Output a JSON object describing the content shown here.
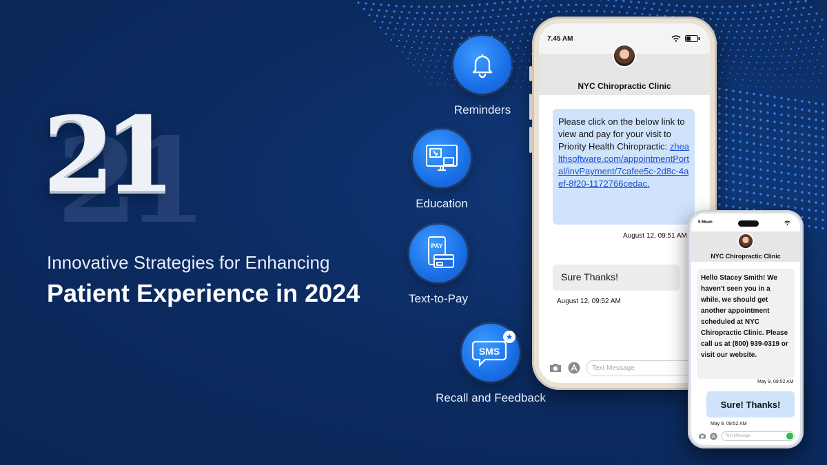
{
  "hero": {
    "number": "21",
    "subtitle": "Innovative Strategies for Enhancing",
    "title": "Patient Experience in 2024"
  },
  "features": [
    {
      "label": "Reminders",
      "icon": "bell-icon"
    },
    {
      "label": "Education",
      "icon": "monitor-icon"
    },
    {
      "label": "Text-to-Pay",
      "icon": "phone-pay-icon",
      "badge": "PAY"
    },
    {
      "label": "Recall and Feedback",
      "icon": "sms-icon",
      "badge": "SMS"
    }
  ],
  "phone_large": {
    "time": "7.45 AM",
    "contact": "NYC Chiropractic Clinic",
    "message_text": "Please click on the below link to view and pay for your visit to Priority Health Chiropractic:",
    "message_link": "zhealthsoftware.com/appointmentPortal/invPayment/7cafee5c-2d8c-4aef-8f20-1172766cedac.",
    "message_time": "August 12,  09:51 AM",
    "reply": "Sure Thanks!",
    "reply_time": "August 12,  09:52 AM",
    "composer_placeholder": "Text Message"
  },
  "phone_small": {
    "time": "9:56am",
    "contact": "NYC Chiropractic Clinic",
    "message": "Hello Stacey Smith! We haven't seen you in a while, we should get another appointment scheduled at NYC Chiropractic Clinic. Please call us at (800) 939-0319 or visit our website.",
    "message_time": "May 9,  09:52 AM",
    "reply": "Sure! Thanks!",
    "reply_time": "May 9,  09:52 AM",
    "composer_placeholder": "Text Message"
  },
  "colors": {
    "background": "#0b2a5e",
    "accent_blue": "#1a6fe6",
    "bubble_blue": "#cfe3fb",
    "send_green": "#2bbf4a"
  }
}
